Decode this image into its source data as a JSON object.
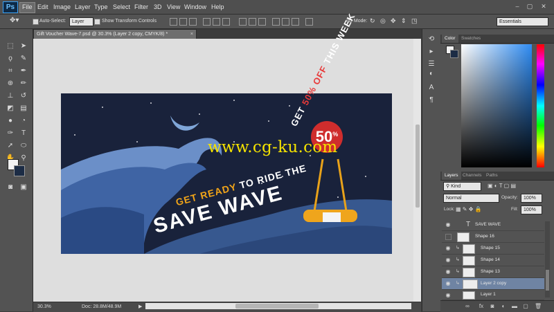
{
  "app": {
    "logo": "Ps",
    "accent": "#3aa0f3"
  },
  "menu": [
    "File",
    "Edit",
    "Image",
    "Layer",
    "Type",
    "Select",
    "Filter",
    "3D",
    "View",
    "Window",
    "Help"
  ],
  "window_controls": [
    "–",
    "▢",
    "✕"
  ],
  "options_bar": {
    "auto_select_label": "Auto-Select:",
    "auto_select_value": "Layer",
    "transform_label": "Show Transform Controls",
    "mode_label": "3D Mode:",
    "workspace": "Essentials"
  },
  "document": {
    "tab_title": "Gift Voucher Wave-7.psd @ 30.3% (Layer 2 copy, CMYK/8) *",
    "tab_close": "×"
  },
  "artwork": {
    "watermark": "www.cg-ku.com",
    "line1_highlight": "GET READY",
    "line1_rest": " TO RIDE THE",
    "line2": "SAVE WAVE",
    "promo_prefix": "GET ",
    "promo_highlight": "50% OFF",
    "promo_suffix": " THIS WEEK",
    "badge_value": "50",
    "badge_unit": "%"
  },
  "status": {
    "zoom": "30.3%",
    "doc": "Doc: 28.8M/48.9M"
  },
  "color_panel": {
    "tabs": [
      "Color",
      "Swatches"
    ],
    "fg": "#f2f2f2",
    "bg": "#1c2c45"
  },
  "layers_panel": {
    "tabs": [
      "Layers",
      "Channels",
      "Paths"
    ],
    "filter": "Kind",
    "blend_mode": "Normal",
    "opacity_label": "Opacity:",
    "opacity": "100%",
    "lock_label": "Lock:",
    "fill_label": "Fill:",
    "fill": "100%",
    "layers": [
      {
        "name": "SAVE WAVE",
        "kind": "text",
        "visible": true,
        "selected": false
      },
      {
        "name": "Shape 16",
        "kind": "shape",
        "visible": false,
        "selected": false
      },
      {
        "name": "Shape 15",
        "kind": "shape",
        "visible": true,
        "selected": false
      },
      {
        "name": "Shape 14",
        "kind": "shape",
        "visible": true,
        "selected": false
      },
      {
        "name": "Shape 13",
        "kind": "shape",
        "visible": true,
        "selected": false
      },
      {
        "name": "Layer 2 copy",
        "kind": "pixel",
        "visible": true,
        "selected": true
      },
      {
        "name": "Layer 1",
        "kind": "pixel",
        "visible": true,
        "selected": false
      }
    ],
    "bottom_icons": [
      "link-icon",
      "fx-icon",
      "mask-icon",
      "adjustment-icon",
      "folder-icon",
      "new-layer-icon",
      "trash-icon"
    ]
  }
}
